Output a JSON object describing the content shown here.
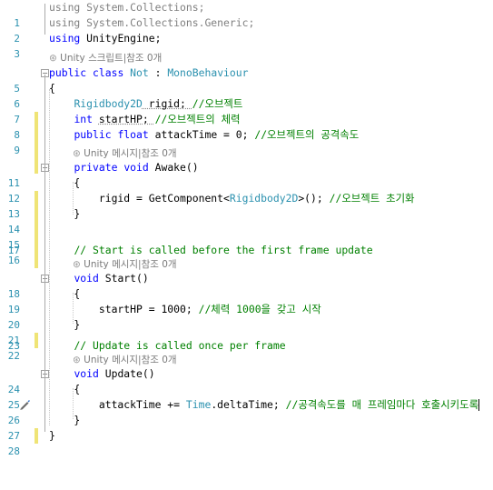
{
  "editor": {
    "lines": [
      {
        "num": "1",
        "segs": [
          {
            "t": "using System.Collections;",
            "c": "gr"
          }
        ]
      },
      {
        "num": "2",
        "segs": [
          {
            "t": "using System.Collections.Generic;",
            "c": "gr"
          }
        ]
      },
      {
        "num": "3",
        "segs": [
          {
            "t": "using ",
            "c": "kw"
          },
          {
            "t": "UnityEngine;",
            "c": "pl"
          }
        ]
      },
      {
        "num": "5",
        "segs": [
          {
            "t": "public ",
            "c": "kw"
          },
          {
            "t": "class ",
            "c": "kw"
          },
          {
            "t": "Not",
            "c": "ty"
          },
          {
            "t": " : ",
            "c": "pl"
          },
          {
            "t": "MonoBehaviour",
            "c": "ty"
          }
        ]
      },
      {
        "num": "6",
        "segs": [
          {
            "t": "{",
            "c": "pl"
          }
        ]
      },
      {
        "num": "7",
        "segs": [
          {
            "t": "    ",
            "c": "pl"
          },
          {
            "t": "Rigidbody2D",
            "c": "ty"
          },
          {
            "t": " rigid; ",
            "c": "pl"
          },
          {
            "t": "//오브젝트",
            "c": "cm"
          }
        ]
      },
      {
        "num": "8",
        "segs": [
          {
            "t": "    ",
            "c": "pl"
          },
          {
            "t": "int ",
            "c": "kw"
          },
          {
            "t": "startHP; ",
            "c": "pl"
          },
          {
            "t": "//오브젝트의 체력",
            "c": "cm"
          }
        ]
      },
      {
        "num": "9",
        "segs": [
          {
            "t": "    ",
            "c": "pl"
          },
          {
            "t": "public ",
            "c": "kw"
          },
          {
            "t": "float ",
            "c": "kw"
          },
          {
            "t": "attackTime = 0; ",
            "c": "pl"
          },
          {
            "t": "//오브젝트의 공격속도",
            "c": "cm"
          }
        ]
      },
      {
        "num": "11",
        "segs": [
          {
            "t": "    ",
            "c": "pl"
          },
          {
            "t": "private ",
            "c": "kw"
          },
          {
            "t": "void ",
            "c": "kw"
          },
          {
            "t": "Awake()",
            "c": "pl"
          }
        ]
      },
      {
        "num": "12",
        "segs": [
          {
            "t": "    {",
            "c": "pl"
          }
        ]
      },
      {
        "num": "13",
        "segs": [
          {
            "t": "        rigid = GetComponent<",
            "c": "pl"
          },
          {
            "t": "Rigidbody2D",
            "c": "ty"
          },
          {
            "t": ">(); ",
            "c": "pl"
          },
          {
            "t": "//오브젝트 초기화",
            "c": "cm"
          }
        ]
      },
      {
        "num": "14",
        "segs": [
          {
            "t": "    }",
            "c": "pl"
          }
        ]
      },
      {
        "num": "15",
        "segs": []
      },
      {
        "num": "16",
        "segs": []
      },
      {
        "num": "17",
        "segs": [
          {
            "t": "    ",
            "c": "pl"
          },
          {
            "t": "// Start is called before the first frame update",
            "c": "cm"
          }
        ]
      },
      {
        "num": "18",
        "segs": [
          {
            "t": "    ",
            "c": "pl"
          },
          {
            "t": "void ",
            "c": "kw"
          },
          {
            "t": "Start()",
            "c": "pl"
          }
        ]
      },
      {
        "num": "19",
        "segs": [
          {
            "t": "    {",
            "c": "pl"
          }
        ]
      },
      {
        "num": "20",
        "segs": [
          {
            "t": "        startHP = 1000; ",
            "c": "pl"
          },
          {
            "t": "//체력 1000을 갖고 시작",
            "c": "cm"
          }
        ]
      },
      {
        "num": "21",
        "segs": [
          {
            "t": "    }",
            "c": "pl"
          }
        ]
      },
      {
        "num": "22",
        "segs": []
      },
      {
        "num": "23",
        "segs": [
          {
            "t": "    ",
            "c": "pl"
          },
          {
            "t": "// Update is called once per frame",
            "c": "cm"
          }
        ]
      },
      {
        "num": "24",
        "segs": [
          {
            "t": "    ",
            "c": "pl"
          },
          {
            "t": "void ",
            "c": "kw"
          },
          {
            "t": "Update()",
            "c": "pl"
          }
        ]
      },
      {
        "num": "25",
        "segs": [
          {
            "t": "    {",
            "c": "pl"
          }
        ]
      },
      {
        "num": "26",
        "segs": [
          {
            "t": "        attackTime += ",
            "c": "pl"
          },
          {
            "t": "Time",
            "c": "ty"
          },
          {
            "t": ".deltaTime; ",
            "c": "pl"
          },
          {
            "t": "//공격속도를 매 프레임마다 호출시키도록",
            "c": "cm"
          }
        ]
      },
      {
        "num": "27",
        "segs": [
          {
            "t": "    }",
            "c": "pl"
          }
        ]
      },
      {
        "num": "28",
        "segs": [
          {
            "t": "}",
            "c": "pl"
          }
        ]
      },
      {
        "num": "29",
        "segs": []
      }
    ],
    "codelens": [
      {
        "after": "3",
        "icon": "⊛",
        "text": "Unity 스크립트|참조 0개"
      },
      {
        "after": "9",
        "icon": "⊛",
        "text": "Unity 메시지|참조 0개"
      },
      {
        "after": "17",
        "icon": "⊛",
        "text": "Unity 메시지|참조 0개"
      },
      {
        "after": "23",
        "icon": "⊛",
        "text": "Unity 메시지|참조 0개"
      }
    ]
  },
  "colors": {
    "keyword": "#0000ff",
    "type": "#2b91af",
    "comment": "#008000",
    "line_number": "#2b91af",
    "change_marker": "#efe476"
  },
  "icons": {
    "fold_toggle": "minus-box-icon",
    "edit_marker": "pencil-icon"
  }
}
